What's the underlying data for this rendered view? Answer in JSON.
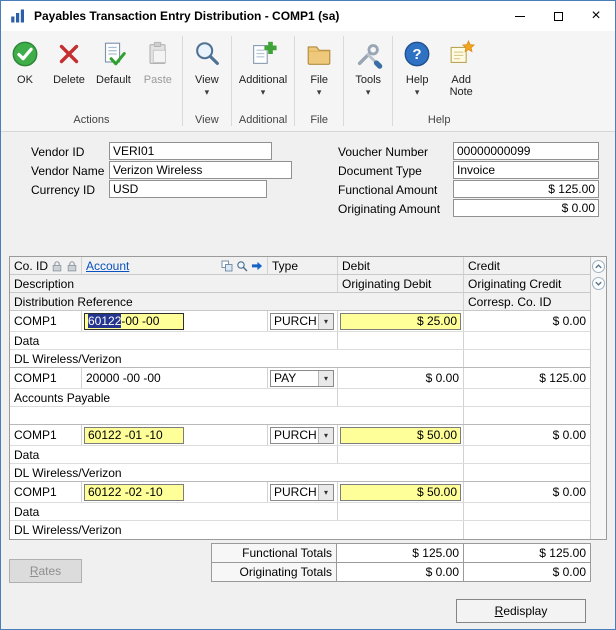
{
  "window": {
    "title": "Payables Transaction Entry Distribution - COMP1 (sa)"
  },
  "glyphs": {
    "dropdown": "▾",
    "close": "×"
  },
  "ribbon": {
    "groups": [
      {
        "label": "Actions",
        "buttons": [
          {
            "label": "OK"
          },
          {
            "label": "Delete"
          },
          {
            "label": "Default"
          },
          {
            "label": "Paste",
            "disabled": true
          }
        ]
      },
      {
        "label": "View",
        "buttons": [
          {
            "label": "View",
            "dropdown": true
          }
        ]
      },
      {
        "label": "Additional",
        "buttons": [
          {
            "label": "Additional",
            "dropdown": true
          }
        ]
      },
      {
        "label": "File",
        "buttons": [
          {
            "label": "File",
            "dropdown": true
          }
        ]
      },
      {
        "label": "",
        "buttons": [
          {
            "label": "Tools",
            "dropdown": true
          }
        ]
      },
      {
        "label": "Help",
        "buttons": [
          {
            "label": "Help",
            "dropdown": true
          },
          {
            "label": "Add Note"
          }
        ]
      }
    ]
  },
  "form": {
    "vendor_id": {
      "label": "Vendor ID",
      "value": "VERI01"
    },
    "vendor_name": {
      "label": "Vendor Name",
      "value": "Verizon Wireless"
    },
    "currency_id": {
      "label": "Currency ID",
      "value": "USD"
    },
    "voucher_number": {
      "label": "Voucher Number",
      "value": "00000000099"
    },
    "document_type": {
      "label": "Document Type",
      "value": "Invoice"
    },
    "functional_amount": {
      "label": "Functional Amount",
      "value": "$ 125.00"
    },
    "originating_amount": {
      "label": "Originating Amount",
      "value": "$ 0.00"
    }
  },
  "grid": {
    "headers": {
      "co_id": "Co. ID",
      "account": "Account",
      "type": "Type",
      "debit": "Debit",
      "credit": "Credit",
      "description": "Description",
      "originating_debit": "Originating Debit",
      "originating_credit": "Originating Credit",
      "distribution_reference": "Distribution Reference",
      "corresp_co_id": "Corresp. Co. ID"
    },
    "rows": [
      {
        "co_id": "COMP1",
        "account": "60122 -00 -00",
        "account_selected": "60122",
        "account_rest": " -00 -00",
        "type": "PURCH",
        "debit": "$ 25.00",
        "credit": "$ 0.00",
        "description": "Data",
        "distribution_reference": "DL Wireless/Verizon",
        "highlighted": true
      },
      {
        "co_id": "COMP1",
        "account": "20000 -00 -00",
        "type": "PAY",
        "debit": "$ 0.00",
        "credit": "$ 125.00",
        "description": "Accounts Payable",
        "distribution_reference": "",
        "highlighted": false
      },
      {
        "co_id": "COMP1",
        "account": "60122 -01 -10",
        "type": "PURCH",
        "debit": "$ 50.00",
        "credit": "$ 0.00",
        "description": "Data",
        "distribution_reference": "DL Wireless/Verizon",
        "highlighted": true
      },
      {
        "co_id": "COMP1",
        "account": "60122 -02 -10",
        "type": "PURCH",
        "debit": "$ 50.00",
        "credit": "$ 0.00",
        "description": "Data",
        "distribution_reference": "DL Wireless/Verizon",
        "highlighted": true
      }
    ]
  },
  "totals": {
    "functional": {
      "label": "Functional Totals",
      "debit": "$ 125.00",
      "credit": "$ 125.00"
    },
    "originating": {
      "label": "Originating Totals",
      "debit": "$ 0.00",
      "credit": "$ 0.00"
    }
  },
  "buttons": {
    "rates": {
      "label": "Rates",
      "mnemonic": "R",
      "rest": "ates",
      "disabled": true
    },
    "redisplay": {
      "label": "Redisplay",
      "mnemonic": "R",
      "rest": "edisplay"
    }
  },
  "colors": {
    "highlight": "#ffff99",
    "selection": "#24348f",
    "account_link": "#0a52bf"
  }
}
